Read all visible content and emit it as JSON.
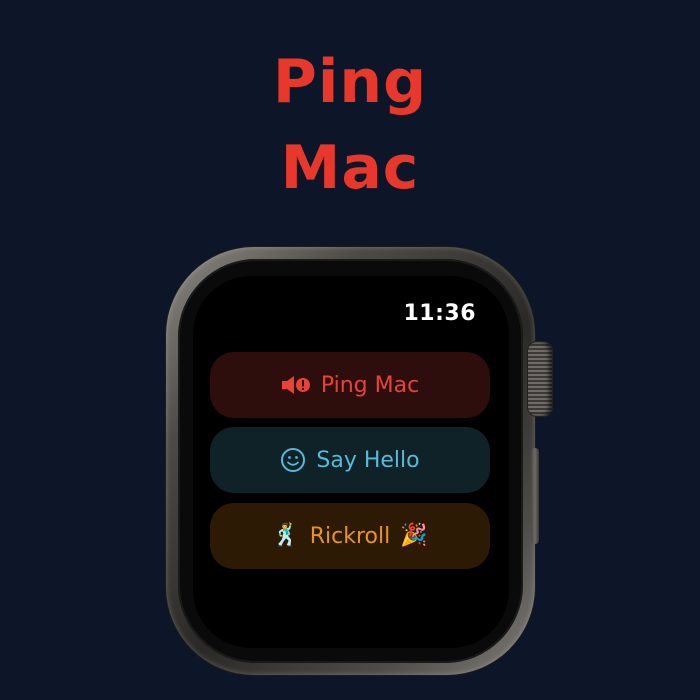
{
  "headline": {
    "line1": "Ping",
    "line2": "Mac"
  },
  "watch": {
    "time": "11:36",
    "buttons": {
      "ping": {
        "label": "Ping Mac",
        "icon": "speaker-alert-icon",
        "color": "#e8423a"
      },
      "hello": {
        "label": "Say Hello",
        "icon": "smiley-icon",
        "color": "#58b9d8"
      },
      "rickroll": {
        "label": "Rickroll",
        "icon_left": "dancer-icon",
        "icon_right": "party-popper-icon",
        "dancer_glyph": "🕺",
        "party_glyph": "🎉",
        "color": "#e8941c"
      }
    }
  },
  "colors": {
    "background": "#0c1628",
    "headline": "#e8372b"
  }
}
